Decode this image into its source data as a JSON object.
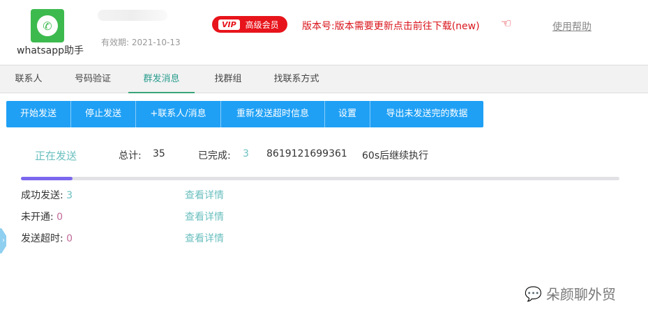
{
  "header": {
    "app_name": "whatsapp助手",
    "expiry": "有效期: 2021-10-13",
    "vip_tag": "VIP",
    "vip_label": "高级会员",
    "version_notice": "版本号:版本需要更新点击前往下载(new)",
    "help_link": "使用帮助"
  },
  "tabs": [
    {
      "label": "联系人"
    },
    {
      "label": "号码验证"
    },
    {
      "label": "群发消息"
    },
    {
      "label": "找群组"
    },
    {
      "label": "找联系方式"
    }
  ],
  "toolbar": [
    "开始发送",
    "停止发送",
    "+联系人/消息",
    "重新发送超时信息",
    "设置",
    "导出未发送完的数据"
  ],
  "status": {
    "state": "正在发送",
    "total_label": "总计:",
    "total": "35",
    "done_label": "已完成:",
    "done": "3",
    "current_number": "8619121699361",
    "countdown": "60s后继续执行",
    "progress_percent": 8.6
  },
  "results": [
    {
      "label": "成功发送:",
      "value": "3",
      "link": "查看详情"
    },
    {
      "label": "未开通:",
      "value": "0",
      "link": "查看详情"
    },
    {
      "label": "发送超时:",
      "value": "0",
      "link": "查看详情"
    }
  ],
  "watermark": "朵颜聊外贸",
  "colors": {
    "accent": "#1fa0f5",
    "vip": "#e8141b",
    "progress": "#7b68ee"
  }
}
